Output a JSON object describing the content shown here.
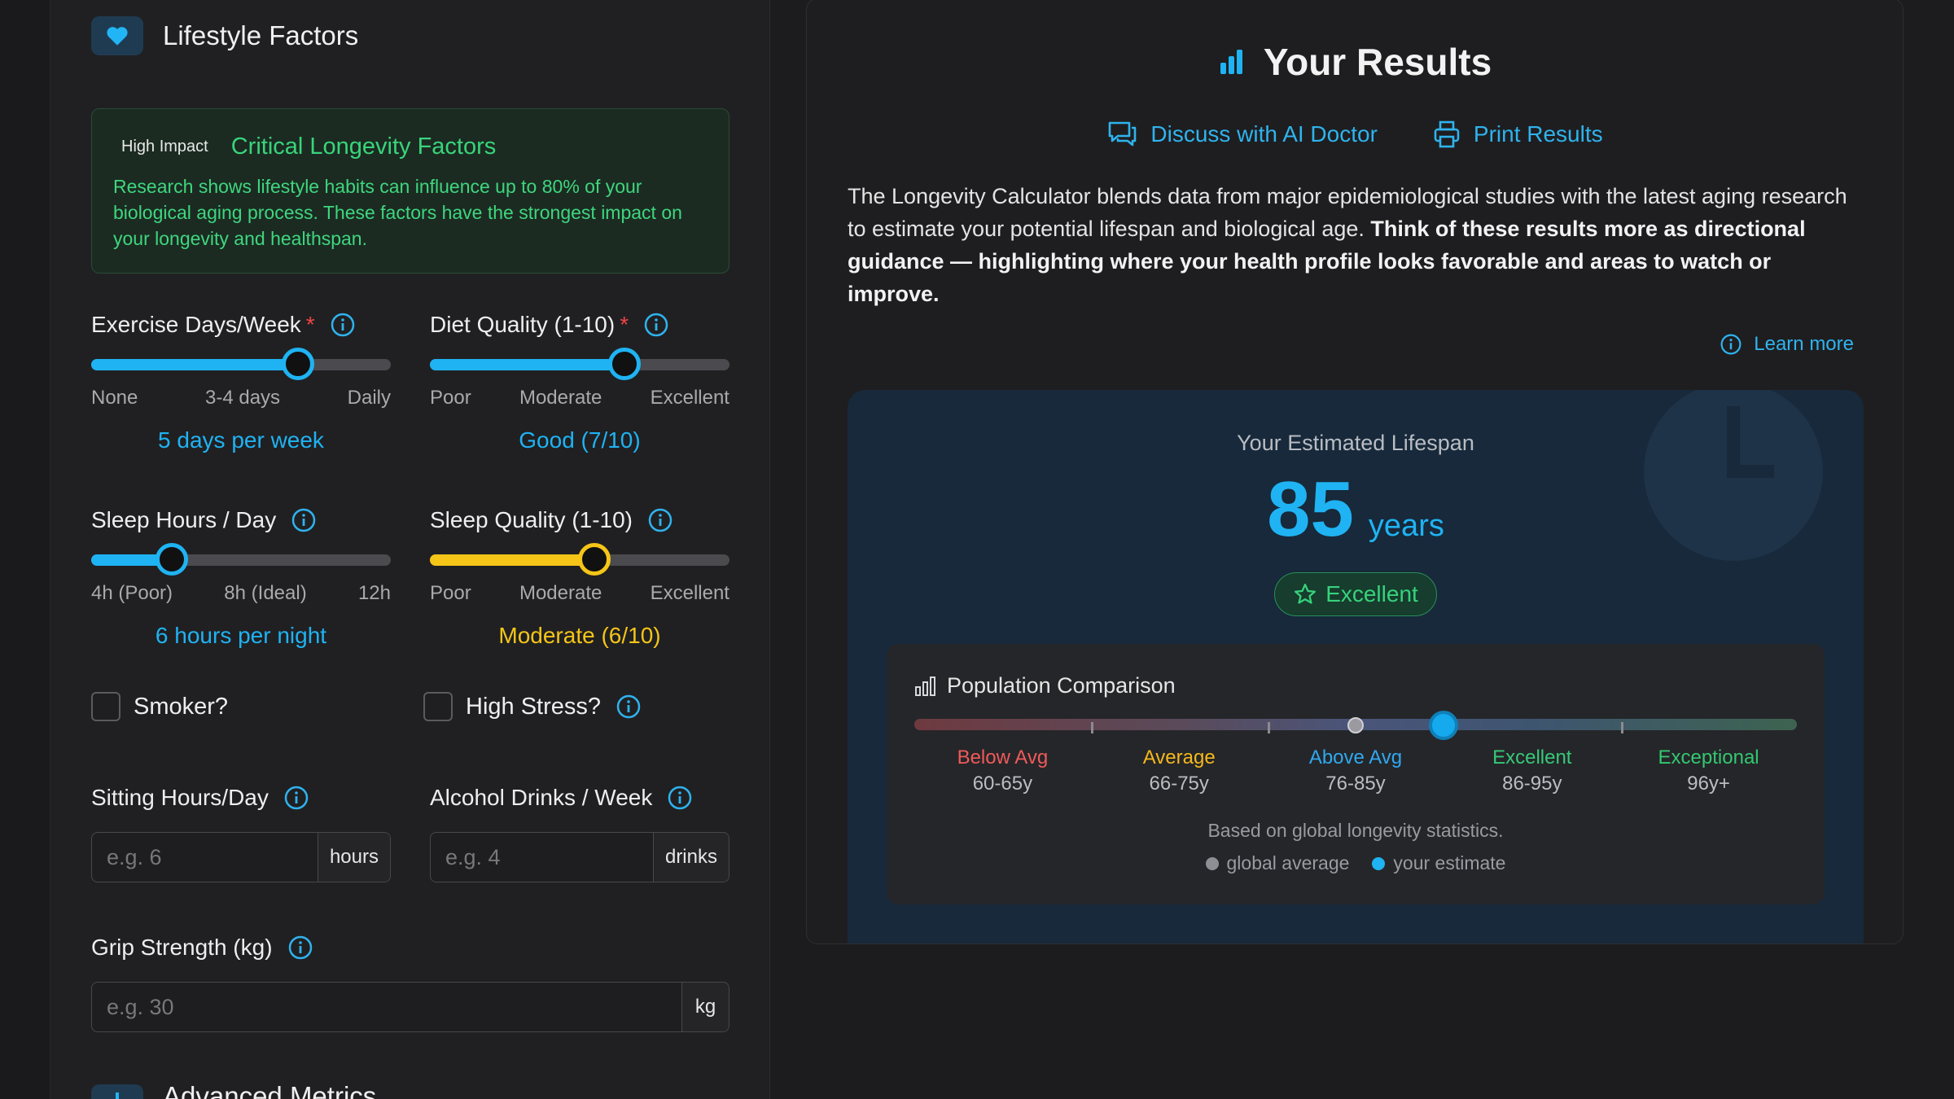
{
  "lifestyle": {
    "title": "Lifestyle Factors",
    "impact_tag": "High Impact",
    "impact_title": "Critical Longevity Factors",
    "impact_text": "Research shows lifestyle habits can influence up to 80% of your biological aging process. These factors have the strongest impact on your longevity and healthspan.",
    "exercise": {
      "label": "Exercise Days/Week",
      "required": "*",
      "scale": [
        "None",
        "3-4 days",
        "Daily"
      ],
      "value_text": "5 days per week",
      "level": 0.69
    },
    "diet": {
      "label": "Diet Quality (1-10)",
      "required": "*",
      "scale": [
        "Poor",
        "Moderate",
        "Excellent"
      ],
      "value_text": "Good (7/10)",
      "level": 0.65
    },
    "sleep_hours": {
      "label": "Sleep Hours / Day",
      "scale": [
        "4h (Poor)",
        "8h (Ideal)",
        "12h"
      ],
      "value_text": "6 hours per night",
      "level": 0.27
    },
    "sleep_quality": {
      "label": "Sleep Quality (1-10)",
      "scale": [
        "Poor",
        "Moderate",
        "Excellent"
      ],
      "value_text": "Moderate (6/10)",
      "level": 0.55
    },
    "smoker": {
      "label": "Smoker?",
      "checked": false
    },
    "stress": {
      "label": "High Stress?",
      "checked": false
    },
    "sitting": {
      "label": "Sitting Hours/Day",
      "placeholder": "e.g. 6",
      "unit": "hours"
    },
    "alcohol": {
      "label": "Alcohol Drinks / Week",
      "placeholder": "e.g. 4",
      "unit": "drinks"
    },
    "grip": {
      "label": "Grip Strength (kg)",
      "placeholder": "e.g. 30",
      "unit": "kg"
    },
    "advanced_title": "Advanced Metrics"
  },
  "results": {
    "title": "Your Results",
    "discuss": "Discuss with AI Doctor",
    "print": "Print Results",
    "desc_plain": "The Longevity Calculator blends data from major epidemiological studies with the latest aging research to estimate your potential lifespan and biological age. ",
    "desc_bold": "Think of these results more as directional guidance — highlighting where your health profile looks favorable and areas to watch or improve.",
    "learn_more": "Learn more",
    "lifespan_label": "Your Estimated Lifespan",
    "lifespan_value": "85",
    "lifespan_unit": "years",
    "badge": "Excellent",
    "population": {
      "title": "Population Comparison",
      "bands": [
        {
          "name": "Below Avg",
          "range": "60-65y",
          "color": "#f05a5a"
        },
        {
          "name": "Average",
          "range": "66-75y",
          "color": "#f5b81c"
        },
        {
          "name": "Above Avg",
          "range": "76-85y",
          "color": "#2fa8f0"
        },
        {
          "name": "Excellent",
          "range": "86-95y",
          "color": "#36c978"
        },
        {
          "name": "Exceptional",
          "range": "96y+",
          "color": "#33c870"
        }
      ],
      "global_average_level": 0.5,
      "your_estimate_level": 0.6,
      "note": "Based on global longevity statistics.",
      "legend_global": "global average",
      "legend_you": "your estimate"
    }
  },
  "colors": {
    "accent_blue": "#1fb3f3",
    "accent_yellow": "#f5c518",
    "accent_green": "#39d47a"
  }
}
